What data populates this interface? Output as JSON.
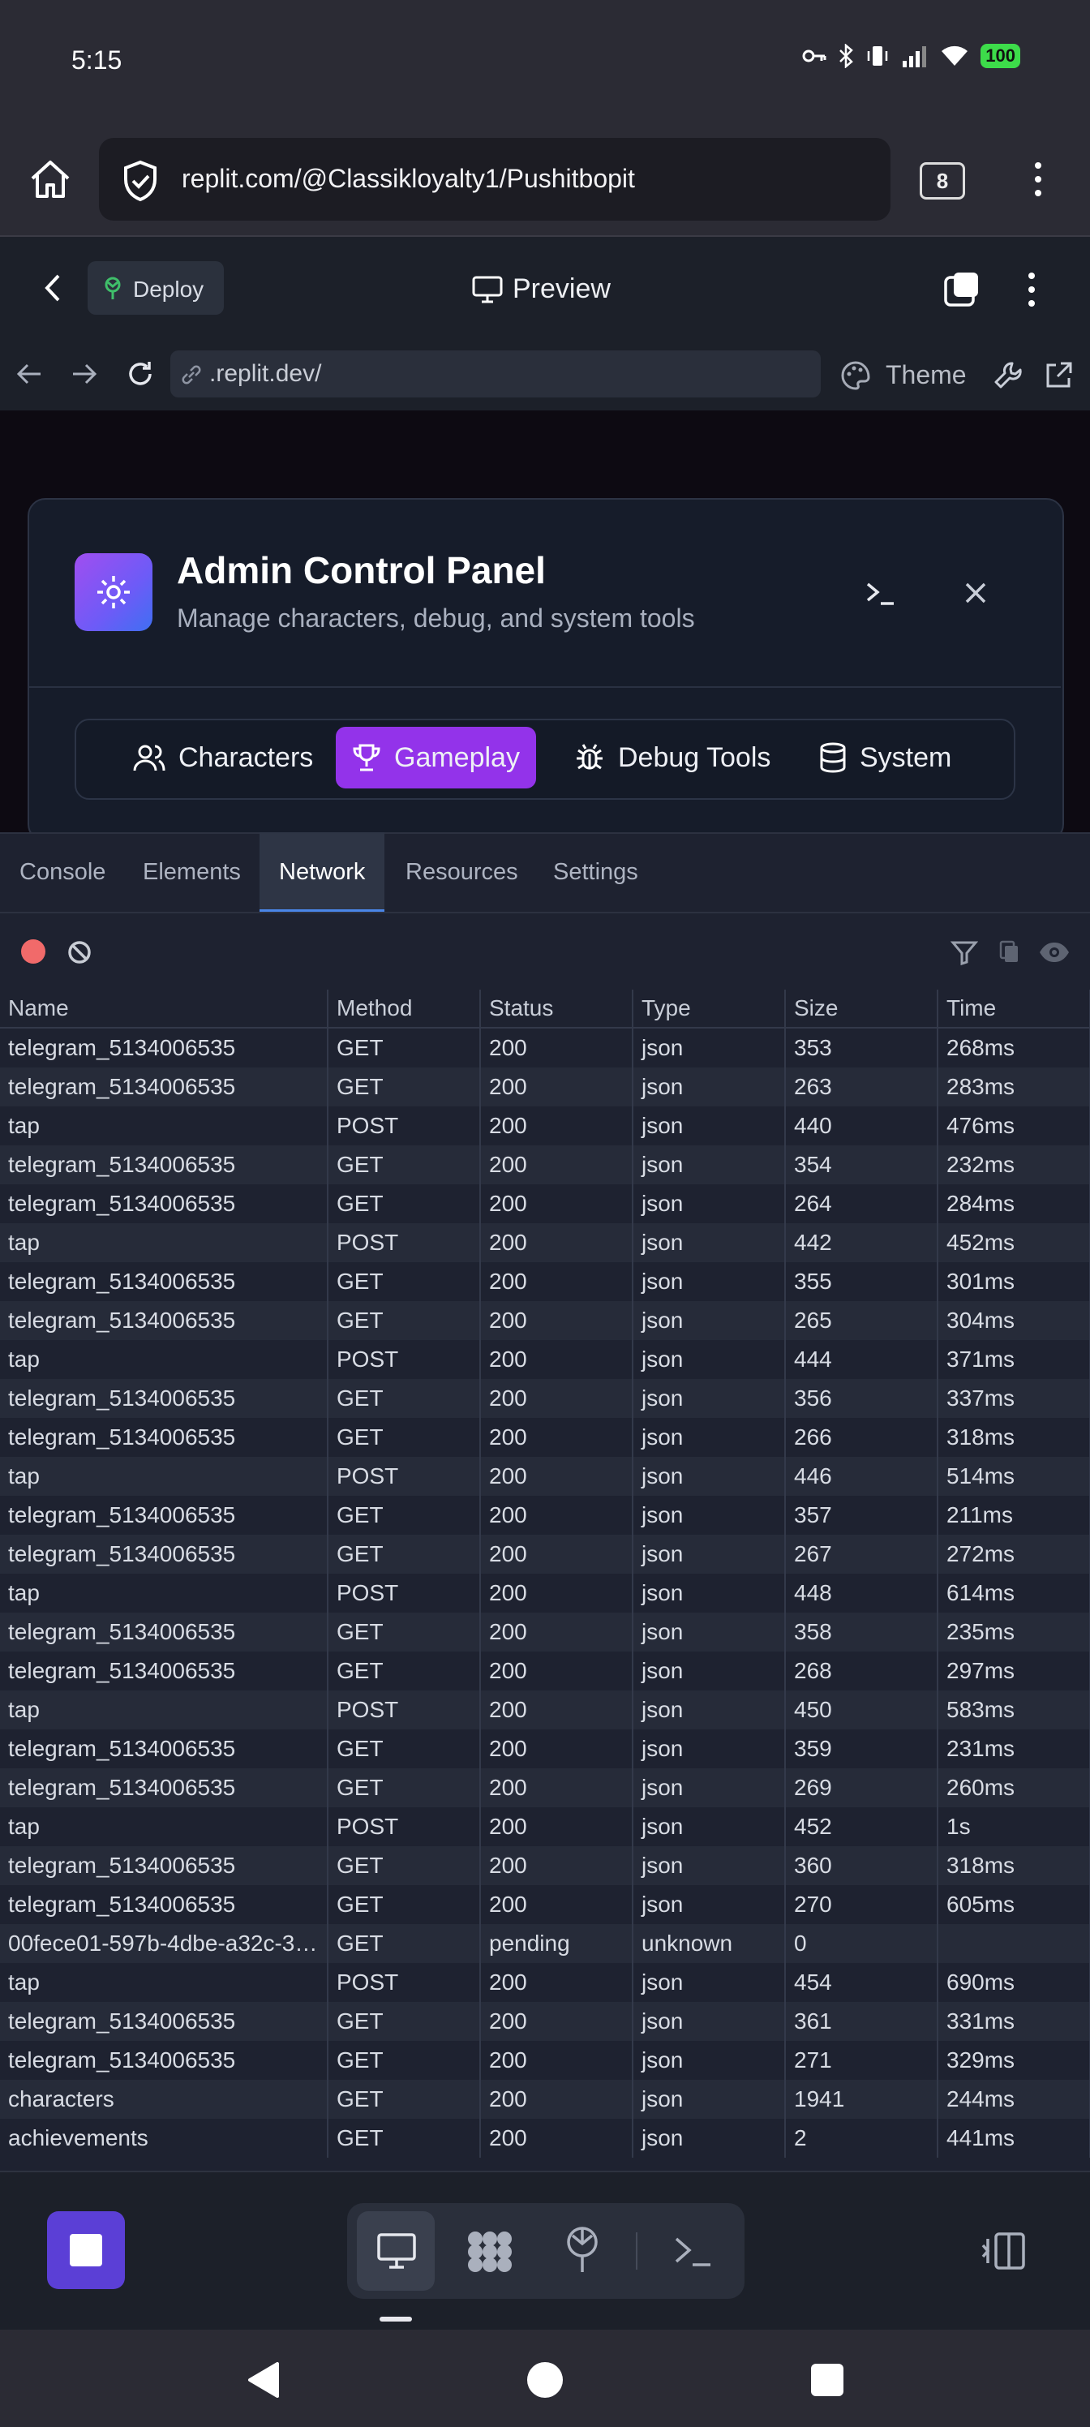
{
  "status_bar": {
    "time": "5:15",
    "battery": "100"
  },
  "browser": {
    "url": "replit.com/@Classikloyalty1/Pushitbopit",
    "tab_count": "8"
  },
  "replit_header": {
    "deploy_label": "Deploy",
    "preview_label": "Preview"
  },
  "preview_bar": {
    "url": ".replit.dev/",
    "theme_label": "Theme"
  },
  "panel": {
    "title": "Admin Control Panel",
    "subtitle": "Manage characters, debug, and system tools",
    "tabs": [
      {
        "label": "Characters",
        "icon": "users-icon",
        "active": false
      },
      {
        "label": "Gameplay",
        "icon": "trophy-icon",
        "active": true
      },
      {
        "label": "Debug Tools",
        "icon": "bug-icon",
        "active": false
      },
      {
        "label": "System",
        "icon": "database-icon",
        "active": false
      }
    ]
  },
  "devtools": {
    "tabs": [
      "Console",
      "Elements",
      "Network",
      "Resources",
      "Settings"
    ],
    "active_tab": "Network",
    "columns": [
      "Name",
      "Method",
      "Status",
      "Type",
      "Size",
      "Time"
    ],
    "rows": [
      [
        "telegram_5134006535",
        "GET",
        "200",
        "json",
        "353",
        "268ms"
      ],
      [
        "telegram_5134006535",
        "GET",
        "200",
        "json",
        "263",
        "283ms"
      ],
      [
        "tap",
        "POST",
        "200",
        "json",
        "440",
        "476ms"
      ],
      [
        "telegram_5134006535",
        "GET",
        "200",
        "json",
        "354",
        "232ms"
      ],
      [
        "telegram_5134006535",
        "GET",
        "200",
        "json",
        "264",
        "284ms"
      ],
      [
        "tap",
        "POST",
        "200",
        "json",
        "442",
        "452ms"
      ],
      [
        "telegram_5134006535",
        "GET",
        "200",
        "json",
        "355",
        "301ms"
      ],
      [
        "telegram_5134006535",
        "GET",
        "200",
        "json",
        "265",
        "304ms"
      ],
      [
        "tap",
        "POST",
        "200",
        "json",
        "444",
        "371ms"
      ],
      [
        "telegram_5134006535",
        "GET",
        "200",
        "json",
        "356",
        "337ms"
      ],
      [
        "telegram_5134006535",
        "GET",
        "200",
        "json",
        "266",
        "318ms"
      ],
      [
        "tap",
        "POST",
        "200",
        "json",
        "446",
        "514ms"
      ],
      [
        "telegram_5134006535",
        "GET",
        "200",
        "json",
        "357",
        "211ms"
      ],
      [
        "telegram_5134006535",
        "GET",
        "200",
        "json",
        "267",
        "272ms"
      ],
      [
        "tap",
        "POST",
        "200",
        "json",
        "448",
        "614ms"
      ],
      [
        "telegram_5134006535",
        "GET",
        "200",
        "json",
        "358",
        "235ms"
      ],
      [
        "telegram_5134006535",
        "GET",
        "200",
        "json",
        "268",
        "297ms"
      ],
      [
        "tap",
        "POST",
        "200",
        "json",
        "450",
        "583ms"
      ],
      [
        "telegram_5134006535",
        "GET",
        "200",
        "json",
        "359",
        "231ms"
      ],
      [
        "telegram_5134006535",
        "GET",
        "200",
        "json",
        "269",
        "260ms"
      ],
      [
        "tap",
        "POST",
        "200",
        "json",
        "452",
        "1s"
      ],
      [
        "telegram_5134006535",
        "GET",
        "200",
        "json",
        "360",
        "318ms"
      ],
      [
        "telegram_5134006535",
        "GET",
        "200",
        "json",
        "270",
        "605ms"
      ],
      [
        "00fece01-597b-4dbe-a32c-3…",
        "GET",
        "pending",
        "unknown",
        "0",
        ""
      ],
      [
        "tap",
        "POST",
        "200",
        "json",
        "454",
        "690ms"
      ],
      [
        "telegram_5134006535",
        "GET",
        "200",
        "json",
        "361",
        "331ms"
      ],
      [
        "telegram_5134006535",
        "GET",
        "200",
        "json",
        "271",
        "329ms"
      ],
      [
        "characters",
        "GET",
        "200",
        "json",
        "1941",
        "244ms"
      ],
      [
        "achievements",
        "GET",
        "200",
        "json",
        "2",
        "441ms"
      ]
    ]
  },
  "colors": {
    "accent_active_tab": "#9333ea",
    "stop_button": "#5b3fd6",
    "record_dot": "#f16a6a",
    "battery": "#3ddc4a"
  }
}
